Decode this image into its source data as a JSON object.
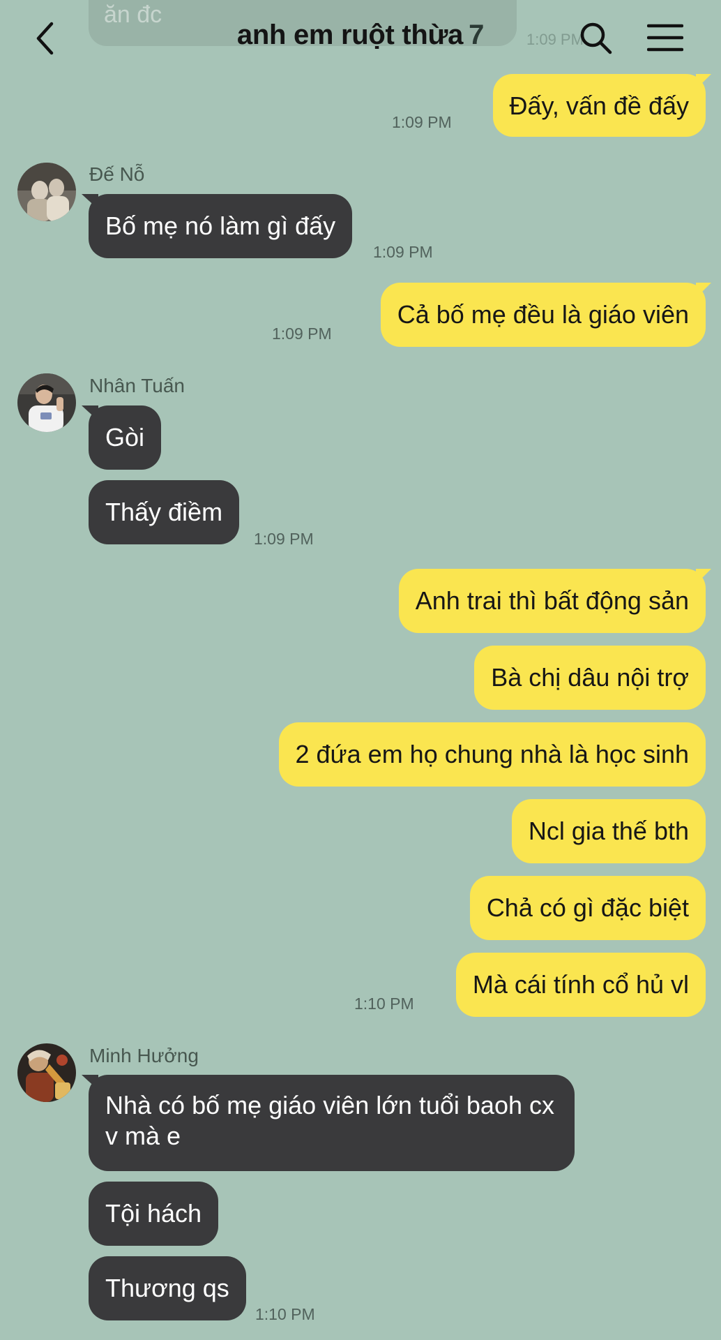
{
  "header": {
    "title": "anh em ruột thừa",
    "member_count": "7"
  },
  "ghost": {
    "text": "ăn đc",
    "time": "1:09 PM"
  },
  "messages": [
    {
      "dir": "out",
      "text": "Đấy, vấn đề đấy",
      "time": "1:09 PM"
    },
    {
      "dir": "in",
      "sender": "Đế Nỗ",
      "text": "Bố mẹ nó làm gì đấy",
      "time": "1:09 PM"
    },
    {
      "dir": "out",
      "text": "Cả bố mẹ đều là giáo viên",
      "time": "1:09 PM"
    },
    {
      "dir": "in",
      "sender": "Nhân Tuấn",
      "text": "Gòi"
    },
    {
      "dir": "in",
      "text": "Thấy điềm",
      "time": "1:09 PM"
    },
    {
      "dir": "out",
      "text": "Anh trai thì bất động sản"
    },
    {
      "dir": "out",
      "text": "Bà chị dâu nội trợ"
    },
    {
      "dir": "out",
      "text": "2 đứa em họ chung nhà là học sinh"
    },
    {
      "dir": "out",
      "text": "Ncl gia thế bth"
    },
    {
      "dir": "out",
      "text": "Chả có gì đặc biệt"
    },
    {
      "dir": "out",
      "text": "Mà cái tính cổ hủ vl",
      "time": "1:10 PM"
    },
    {
      "dir": "in",
      "sender": "Minh Hưởng",
      "text": "Nhà có bố mẹ giáo viên lớn tuổi baoh cx v mà e"
    },
    {
      "dir": "in",
      "text": "Tội hách"
    },
    {
      "dir": "in",
      "text": "Thương qs",
      "time": "1:10 PM"
    }
  ],
  "icons": {
    "back": "chevron-left-icon",
    "search": "search-icon",
    "menu": "hamburger-menu-icon"
  },
  "colors": {
    "background": "#a7c4b7",
    "outgoing_bubble": "#fae550",
    "incoming_bubble": "#3a3a3c"
  }
}
